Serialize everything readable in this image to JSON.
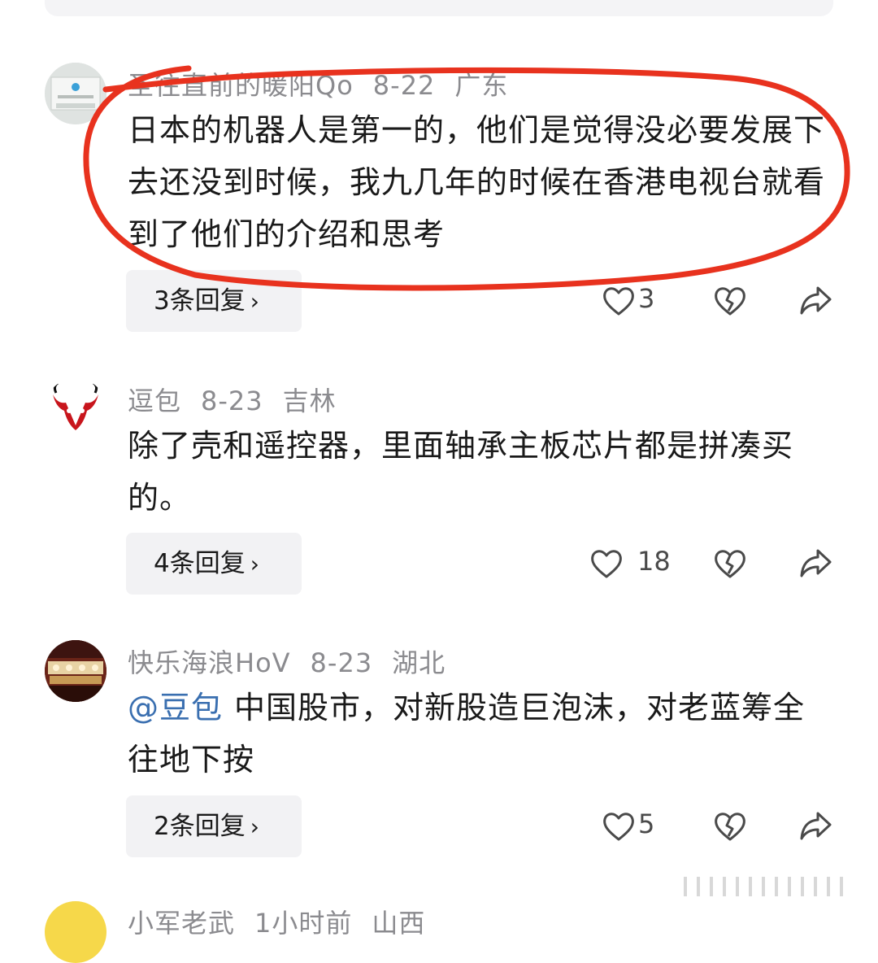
{
  "comments": [
    {
      "username": "圣往直前的暖阳Qo",
      "date": "8-22",
      "location": "广东",
      "text": "日本的机器人是第一的，他们是觉得没必要发展下去还没到时候，我九几年的时候在香港电视台就看到了他们的介绍和思考",
      "reply_label": "3条回复",
      "like_count": "3"
    },
    {
      "username": "逗包",
      "date": "8-23",
      "location": "吉林",
      "text": "除了壳和遥控器，里面轴承主板芯片都是拼凑买的。",
      "reply_label": "4条回复",
      "like_count": "18"
    },
    {
      "username": "快乐海浪HoV",
      "date": "8-23",
      "location": "湖北",
      "mention": "@豆包",
      "text": "中国股市，对新股造巨泡沫，对老蓝筹全往地下按",
      "reply_label": "2条回复",
      "like_count": "5"
    },
    {
      "username": "小军老武",
      "date": "1小时前",
      "location": "山西"
    }
  ],
  "icons": {
    "like": "heart-outline-icon",
    "dislike": "broken-heart-icon",
    "share": "share-arrow-icon"
  },
  "colors": {
    "annotation_circle": "#e8321e",
    "mention": "#3a6fb0",
    "meta_text": "#8b8b8f"
  }
}
